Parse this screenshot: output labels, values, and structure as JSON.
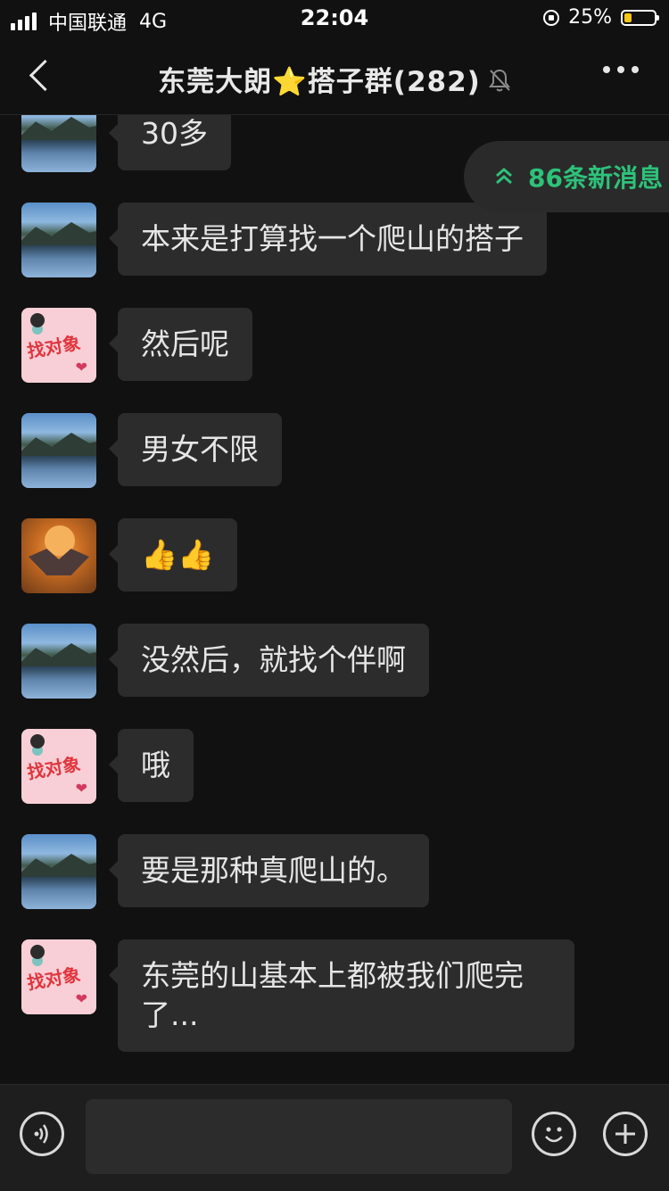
{
  "status_bar": {
    "carrier": "中国联通",
    "network": "4G",
    "time": "22:04",
    "battery": "25%",
    "battery_level": 0.25
  },
  "header": {
    "title_prefix": "东莞大朗",
    "title_suffix": "搭子群(282)",
    "star": "⭐"
  },
  "new_messages": {
    "label": "86条新消息",
    "accent": "#2dc27a"
  },
  "messages": [
    {
      "avatar": "lake",
      "text": "30多"
    },
    {
      "avatar": "lake",
      "text": "本来是打算找一个爬山的搭子"
    },
    {
      "avatar": "pink",
      "text": "然后呢"
    },
    {
      "avatar": "lake",
      "text": "男女不限"
    },
    {
      "avatar": "dog",
      "text": "👍👍"
    },
    {
      "avatar": "lake",
      "text": "没然后，就找个伴啊"
    },
    {
      "avatar": "pink",
      "text": "哦"
    },
    {
      "avatar": "lake",
      "text": "要是那种真爬山的。"
    },
    {
      "avatar": "pink",
      "text": "东莞的山基本上都被我们爬完\n了..."
    }
  ],
  "avatar_pink_text": "找对象",
  "input": {
    "value": ""
  }
}
